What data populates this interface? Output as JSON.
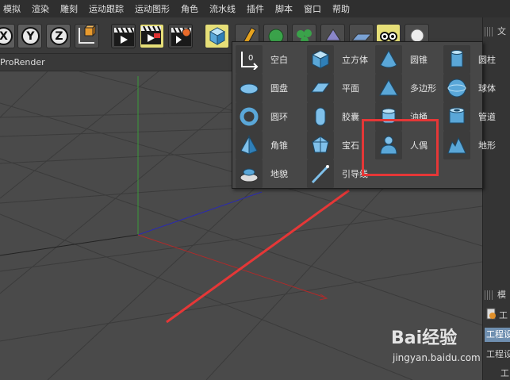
{
  "menu": [
    "模拟",
    "渲染",
    "雕刻",
    "运动跟踪",
    "运动图形",
    "角色",
    "流水线",
    "插件",
    "脚本",
    "窗口",
    "帮助"
  ],
  "toolbar": {
    "axis_buttons": [
      "X",
      "Y",
      "Z"
    ],
    "highlight_color": "#e6df78"
  },
  "viewport": {
    "header_label": "ProRender"
  },
  "popup": {
    "columns": [
      [
        {
          "label": "空白",
          "icon": "null-object-icon"
        },
        {
          "label": "圆盘",
          "icon": "disc-icon"
        },
        {
          "label": "圆环",
          "icon": "torus-icon"
        },
        {
          "label": "角锥",
          "icon": "pyramid-icon"
        },
        {
          "label": "地貌",
          "icon": "landscape-icon"
        }
      ],
      [
        {
          "label": "立方体",
          "icon": "cube-icon"
        },
        {
          "label": "平面",
          "icon": "plane-icon"
        },
        {
          "label": "胶囊",
          "icon": "capsule-icon"
        },
        {
          "label": "宝石",
          "icon": "gem-icon"
        },
        {
          "label": "引导线",
          "icon": "guide-icon"
        }
      ],
      [
        {
          "label": "圆锥",
          "icon": "cone-icon"
        },
        {
          "label": "多边形",
          "icon": "polygon-icon"
        },
        {
          "label": "油桶",
          "icon": "oil-tank-icon"
        },
        {
          "label": "人偶",
          "icon": "figure-icon"
        }
      ],
      [
        {
          "label": "圆柱",
          "icon": "cylinder-icon"
        },
        {
          "label": "球体",
          "icon": "sphere-icon"
        },
        {
          "label": "管道",
          "icon": "tube-icon"
        },
        {
          "label": "地形",
          "icon": "terrain-icon"
        }
      ]
    ]
  },
  "right_panel": {
    "tab_top": "文",
    "tab_mid": "模",
    "project_button": "工程设",
    "project_label_1": "工",
    "project_label_2": "工程设",
    "project_label_3": "工"
  },
  "watermark": {
    "logo": "Bai经验",
    "url": "jingyan.baidu.com"
  },
  "annotation_color": "#e53737"
}
